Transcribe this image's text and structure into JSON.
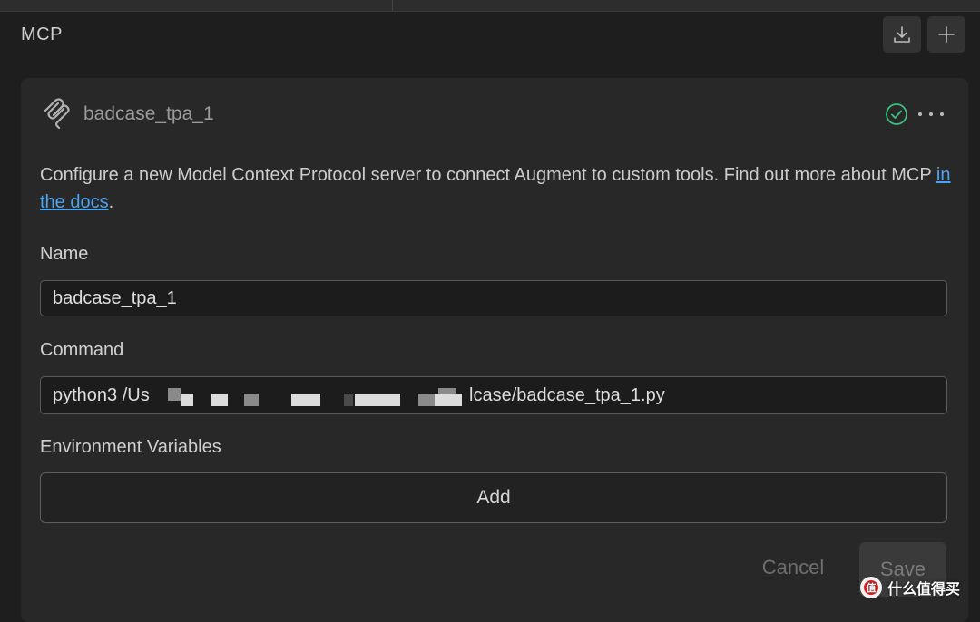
{
  "header": {
    "title": "MCP",
    "import_icon": "download-icon",
    "add_icon": "plus-icon"
  },
  "server": {
    "icon": "mcp-logo-icon",
    "name": "badcase_tpa_1",
    "status_icon": "check-circle-icon",
    "status_color": "#3fbf7f",
    "menu_icon": "more-horizontal-icon"
  },
  "description": {
    "text_before": "Configure a new Model Context Protocol server to connect Augment to custom tools. Find out more about MCP ",
    "link_text": "in the docs",
    "text_after": ".",
    "link_color": "#4fa3ef"
  },
  "form": {
    "name_label": "Name",
    "name_value": "badcase_tpa_1",
    "command_label": "Command",
    "command_visible_start": "python3 /Us",
    "command_visible_end": "lcase/badcase_tpa_1.py",
    "env_label": "Environment Variables",
    "add_label": "Add"
  },
  "actions": {
    "cancel_label": "Cancel",
    "save_label": "Save"
  },
  "watermark": {
    "text": "什么值得买",
    "icon": "smzdm-logo-icon"
  }
}
